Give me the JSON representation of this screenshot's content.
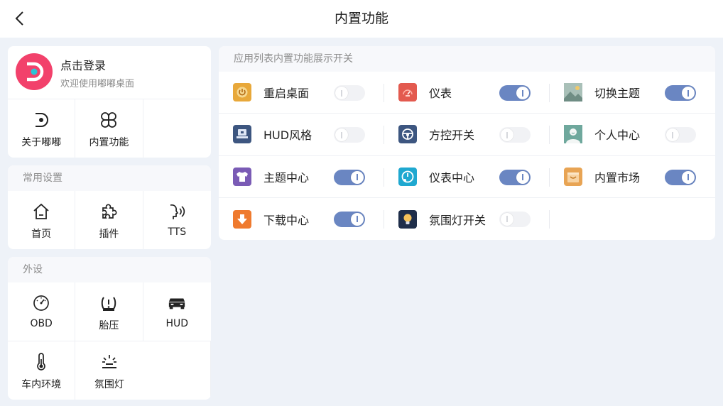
{
  "header": {
    "title": "内置功能"
  },
  "profile": {
    "login": "点击登录",
    "subtitle": "欢迎使用嘟嘟桌面"
  },
  "profile_items": [
    {
      "label": "关于嘟嘟",
      "icon": "dudu-logo-icon"
    },
    {
      "label": "内置功能",
      "icon": "grid-flower-icon"
    }
  ],
  "common": {
    "title": "常用设置",
    "items": [
      {
        "label": "首页",
        "icon": "home-icon"
      },
      {
        "label": "插件",
        "icon": "puzzle-icon"
      },
      {
        "label": "TTS",
        "icon": "voice-icon"
      }
    ]
  },
  "peripherals": {
    "title": "外设",
    "items": [
      {
        "label": "OBD",
        "icon": "gauge-icon"
      },
      {
        "label": "胎压",
        "icon": "tire-pressure-icon"
      },
      {
        "label": "HUD",
        "icon": "hud-car-icon"
      },
      {
        "label": "车内环境",
        "icon": "thermometer-icon"
      },
      {
        "label": "氛围灯",
        "icon": "ambient-light-icon"
      }
    ]
  },
  "features": {
    "title": "应用列表内置功能展示开关",
    "items": [
      {
        "label": "重启桌面",
        "on": false,
        "color": "#e8a83a",
        "icon": "power-icon"
      },
      {
        "label": "仪表",
        "on": true,
        "color": "#e35a4f",
        "icon": "dashboard-icon"
      },
      {
        "label": "切换主题",
        "on": true,
        "color": "#8fa8a0",
        "icon": "image-icon"
      },
      {
        "label": "HUD风格",
        "on": false,
        "color": "#3d5680",
        "icon": "hud-style-icon"
      },
      {
        "label": "方控开关",
        "on": false,
        "color": "#3d5680",
        "icon": "steering-wheel-icon"
      },
      {
        "label": "个人中心",
        "on": false,
        "color": "#5f9a8f",
        "icon": "user-icon"
      },
      {
        "label": "主题中心",
        "on": true,
        "color": "#7a5bb5",
        "icon": "shirt-icon"
      },
      {
        "label": "仪表中心",
        "on": true,
        "color": "#1fa8d0",
        "icon": "dial-icon"
      },
      {
        "label": "内置市场",
        "on": true,
        "color": "#e8a454",
        "icon": "market-icon"
      },
      {
        "label": "下载中心",
        "on": true,
        "color": "#ef7a2e",
        "icon": "download-icon"
      },
      {
        "label": "氛围灯开关",
        "on": false,
        "color": "#1f2e4a",
        "icon": "bulb-icon"
      }
    ]
  }
}
